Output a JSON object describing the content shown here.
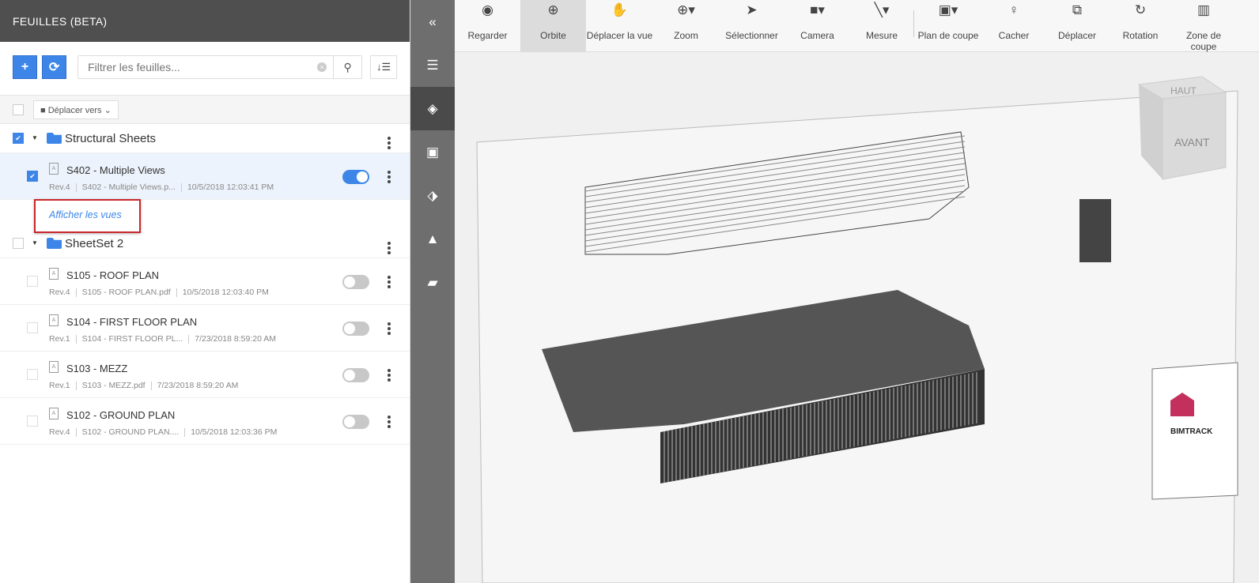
{
  "panel": {
    "title": "FEUILLES (BETA)",
    "search_placeholder": "Filtrer les feuilles...",
    "move_to": "Déplacer vers",
    "show_views": "Afficher les vues"
  },
  "folders": [
    {
      "name": "Structural Sheets",
      "checked": true,
      "sheets": [
        {
          "title": "S402 - Multiple Views",
          "rev": "Rev.4",
          "file": "S402 - Multiple Views.p...",
          "date": "10/5/2018 12:03:41 PM",
          "checked": true,
          "visible": true
        }
      ]
    },
    {
      "name": "SheetSet 2",
      "checked": false,
      "sheets": [
        {
          "title": "S105 - ROOF PLAN",
          "rev": "Rev.4",
          "file": "S105 - ROOF PLAN.pdf",
          "date": "10/5/2018 12:03:40 PM",
          "checked": false,
          "visible": false
        },
        {
          "title": "S104 - FIRST FLOOR PLAN",
          "rev": "Rev.1",
          "file": "S104 - FIRST FLOOR PL...",
          "date": "7/23/2018 8:59:20 AM",
          "checked": false,
          "visible": false
        },
        {
          "title": "S103 - MEZZ",
          "rev": "Rev.1",
          "file": "S103 - MEZZ.pdf",
          "date": "7/23/2018 8:59:20 AM",
          "checked": false,
          "visible": false
        },
        {
          "title": "S102 - GROUND PLAN",
          "rev": "Rev.4",
          "file": "S102 - GROUND PLAN....",
          "date": "10/5/2018 12:03:36 PM",
          "checked": false,
          "visible": false
        }
      ]
    }
  ],
  "rail": [
    "collapse-icon",
    "sheets-list-icon",
    "layers-icon",
    "keyhole-icon",
    "tags-icon",
    "warning-icon",
    "folder-open-icon"
  ],
  "toolbar": [
    {
      "label": "Regarder",
      "icon": "eye-icon"
    },
    {
      "label": "Orbite",
      "icon": "orbit-icon",
      "active": true
    },
    {
      "label": "Déplacer la vue",
      "icon": "hand-icon"
    },
    {
      "label": "Zoom",
      "icon": "zoom-icon"
    },
    {
      "label": "Sélectionner",
      "icon": "cursor-icon"
    },
    {
      "label": "Camera",
      "icon": "camera-icon"
    },
    {
      "label": "Mesure",
      "icon": "ruler-icon"
    },
    {
      "label": "Plan de coupe",
      "icon": "section-plane-icon"
    },
    {
      "label": "Cacher",
      "icon": "bulb-icon"
    },
    {
      "label": "Déplacer",
      "icon": "move-icon"
    },
    {
      "label": "Rotation",
      "icon": "rotate-icon"
    },
    {
      "label": "Zone de coupe",
      "icon": "section-box-icon"
    }
  ],
  "viewcube": {
    "top": "HAUT",
    "front": "AVANT"
  },
  "logo": "BIMTRACK",
  "accent": "#3d86e8"
}
